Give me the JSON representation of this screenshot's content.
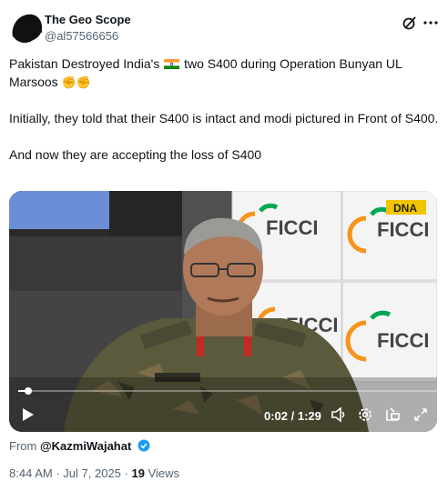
{
  "author": {
    "display_name": "The Geo Scope",
    "handle": "@al57566656"
  },
  "tweet": {
    "para1_part1": "Pakistan Destroyed India's",
    "para1_part2": "two S400 during Operation Bunyan UL Marsoos",
    "para2": "Initially, they told that their S400 is intact and modi pictured in Front of S400.",
    "para3": "And now they are accepting the loss of S400"
  },
  "icons": [
    "grok-icon",
    "more-icon",
    "india-flag-icon",
    "fist-emoji-icon",
    "play-icon",
    "volume-icon",
    "settings-icon",
    "pip-icon",
    "fullscreen-icon",
    "verified-badge-icon"
  ],
  "video": {
    "time_display": "0:02 / 1:29",
    "progress": 0.022,
    "backdrop_text_1": "FICCI",
    "backdrop_text_2": "FICCI",
    "backdrop_text_3": "FICCI",
    "backdrop_text_4": "FICCI",
    "watermark": "DNA"
  },
  "from": {
    "prefix": "From",
    "account": "@KazmiWajahat"
  },
  "meta": {
    "time": "8:44 AM",
    "separator": "·",
    "date": "Jul 7, 2025",
    "views_count": "19",
    "views_label": "Views"
  },
  "colors": {
    "text": "#0f1419",
    "secondary": "#536471",
    "verified": "#1d9bf0"
  }
}
